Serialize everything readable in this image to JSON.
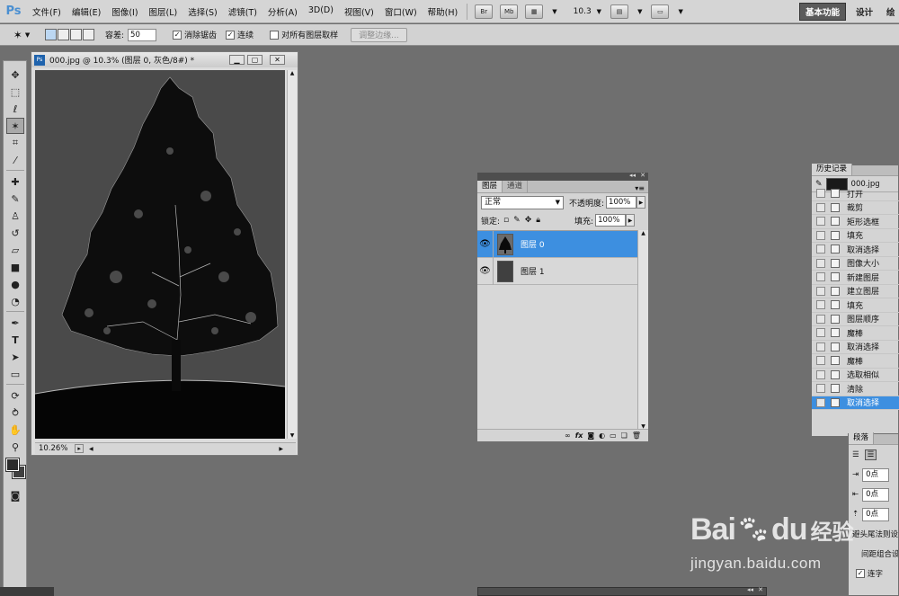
{
  "app": {
    "logo": "Ps"
  },
  "menu": [
    "文件(F)",
    "编辑(E)",
    "图像(I)",
    "图层(L)",
    "选择(S)",
    "滤镜(T)",
    "分析(A)",
    "3D(D)",
    "视图(V)",
    "窗口(W)",
    "帮助(H)"
  ],
  "menubar": {
    "br_label": "Br",
    "mb_label": "Mb",
    "zoom_value": "10.3"
  },
  "workspaces": {
    "essentials": "基本功能",
    "design": "设计",
    "painting": "绘"
  },
  "options": {
    "tolerance_label": "容差:",
    "tolerance_value": "50",
    "antialias_label": "消除锯齿",
    "contiguous_label": "连续",
    "sample_all_label": "对所有图层取样",
    "refine_edge_label": "调整边缘..."
  },
  "document": {
    "title": "000.jpg @ 10.3% (图层 0, 灰色/8#) *",
    "zoom": "10.26%"
  },
  "layers_panel": {
    "tabs": [
      "图层",
      "通道"
    ],
    "blend_mode": "正常",
    "opacity_label": "不透明度:",
    "opacity_value": "100%",
    "lock_label": "锁定:",
    "fill_label": "填充:",
    "fill_value": "100%",
    "layers": [
      {
        "name": "图层 0",
        "selected": true
      },
      {
        "name": "图层 1",
        "selected": false
      }
    ],
    "footer_icons": [
      "link-icon",
      "fx-icon",
      "mask-icon",
      "adjustment-icon",
      "folder-icon",
      "new-layer-icon",
      "trash-icon"
    ]
  },
  "history_panel": {
    "tab": "历史记录",
    "snapshot": "000.jpg",
    "items": [
      {
        "label": "打开",
        "selected": false
      },
      {
        "label": "裁剪",
        "selected": false
      },
      {
        "label": "矩形选框",
        "selected": false
      },
      {
        "label": "填充",
        "selected": false
      },
      {
        "label": "取消选择",
        "selected": false
      },
      {
        "label": "图像大小",
        "selected": false
      },
      {
        "label": "新建图层",
        "selected": false
      },
      {
        "label": "建立图层",
        "selected": false
      },
      {
        "label": "填充",
        "selected": false
      },
      {
        "label": "图层顺序",
        "selected": false
      },
      {
        "label": "魔棒",
        "selected": false
      },
      {
        "label": "取消选择",
        "selected": false
      },
      {
        "label": "魔棒",
        "selected": false
      },
      {
        "label": "选取相似",
        "selected": false
      },
      {
        "label": "清除",
        "selected": false
      },
      {
        "label": "取消选择",
        "selected": true
      }
    ]
  },
  "paragraph_panel": {
    "tab": "段落",
    "indent_left": "0点",
    "indent_first": "0点",
    "space_before": "0点",
    "kinsoku_label": "避头尾法则设",
    "mojikumi_label": "间距组合设",
    "hyphenate_label": "连字"
  },
  "watermark": {
    "logo": "Bai",
    "logo_end": "du",
    "cn": "经验",
    "url": "jingyan.baidu.com"
  }
}
